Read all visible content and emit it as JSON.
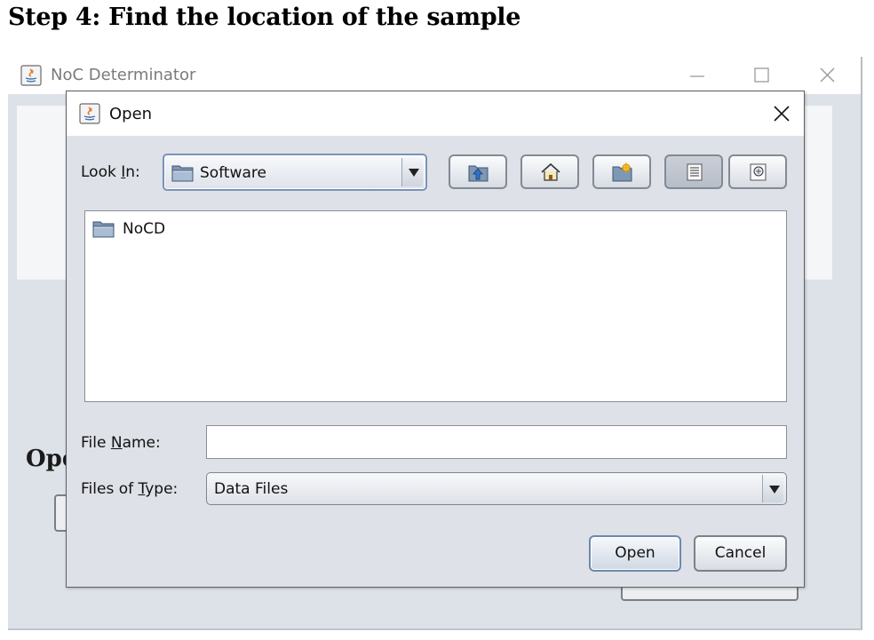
{
  "heading": "Step 4: Find the location of the sample",
  "main_window": {
    "title": "NoC Determinator",
    "partial_label": "Ope"
  },
  "dialog": {
    "title": "Open",
    "look_in_label_pre": "Look ",
    "look_in_label_mnemonic": "I",
    "look_in_label_post": "n:",
    "look_in_value": "Software",
    "files": [
      {
        "name": "NoCD",
        "icon": "folder-icon"
      }
    ],
    "file_name_label_pre": "File ",
    "file_name_label_mnemonic": "N",
    "file_name_label_post": "ame:",
    "file_name_value": "",
    "files_of_type_label_pre": "Files of ",
    "files_of_type_label_mnemonic": "T",
    "files_of_type_label_post": "ype:",
    "files_of_type_value": "Data Files",
    "open_button": "Open",
    "cancel_button": "Cancel",
    "toolbar_icons": [
      "up-one-level-icon",
      "home-icon",
      "new-folder-icon",
      "list-view-icon",
      "details-view-icon"
    ]
  },
  "colors": {
    "dialog_bg": "#dee1e7",
    "main_bg": "#dde1e8",
    "accent_border": "#7a93b8"
  }
}
